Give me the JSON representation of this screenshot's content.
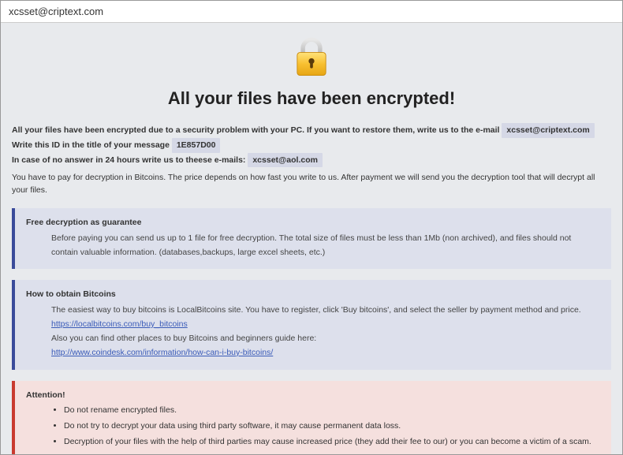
{
  "window": {
    "title": "xcsset@criptext.com"
  },
  "header": {
    "heading": "All your files have been encrypted!"
  },
  "intro": {
    "line1_prefix": "All your files have been encrypted due to a security problem with your PC. If you want to restore them, write us to the e-mail ",
    "email1": "xcsset@criptext.com",
    "line2_prefix": "Write this ID in the title of your message ",
    "id_value": "1E857D00",
    "line3_prefix": "In case of no answer in 24 hours write us to theese e-mails: ",
    "email2": "xcsset@aol.com",
    "payline": "You have to pay for decryption in Bitcoins. The price depends on how fast you write to us. After payment we will send you the decryption tool that will decrypt all your files."
  },
  "guarantee": {
    "title": "Free decryption as guarantee",
    "body": "Before paying you can send us up to 1 file for free decryption. The total size of files must be less than 1Mb (non archived), and files should not contain valuable information. (databases,backups, large excel sheets, etc.)"
  },
  "bitcoins": {
    "title": "How to obtain Bitcoins",
    "line1": "The easiest way to buy bitcoins is LocalBitcoins site. You have to register, click 'Buy bitcoins', and select the seller by payment method and price.",
    "link1": "https://localbitcoins.com/buy_bitcoins",
    "line2": "Also you can find other places to buy Bitcoins and beginners guide here:",
    "link2": "http://www.coindesk.com/information/how-can-i-buy-bitcoins/"
  },
  "attention": {
    "title": "Attention!",
    "items": [
      "Do not rename encrypted files.",
      "Do not try to decrypt your data using third party software, it may cause permanent data loss.",
      "Decryption of your files with the help of third parties may cause increased price (they add their fee to our) or you can become a victim of a scam."
    ]
  }
}
